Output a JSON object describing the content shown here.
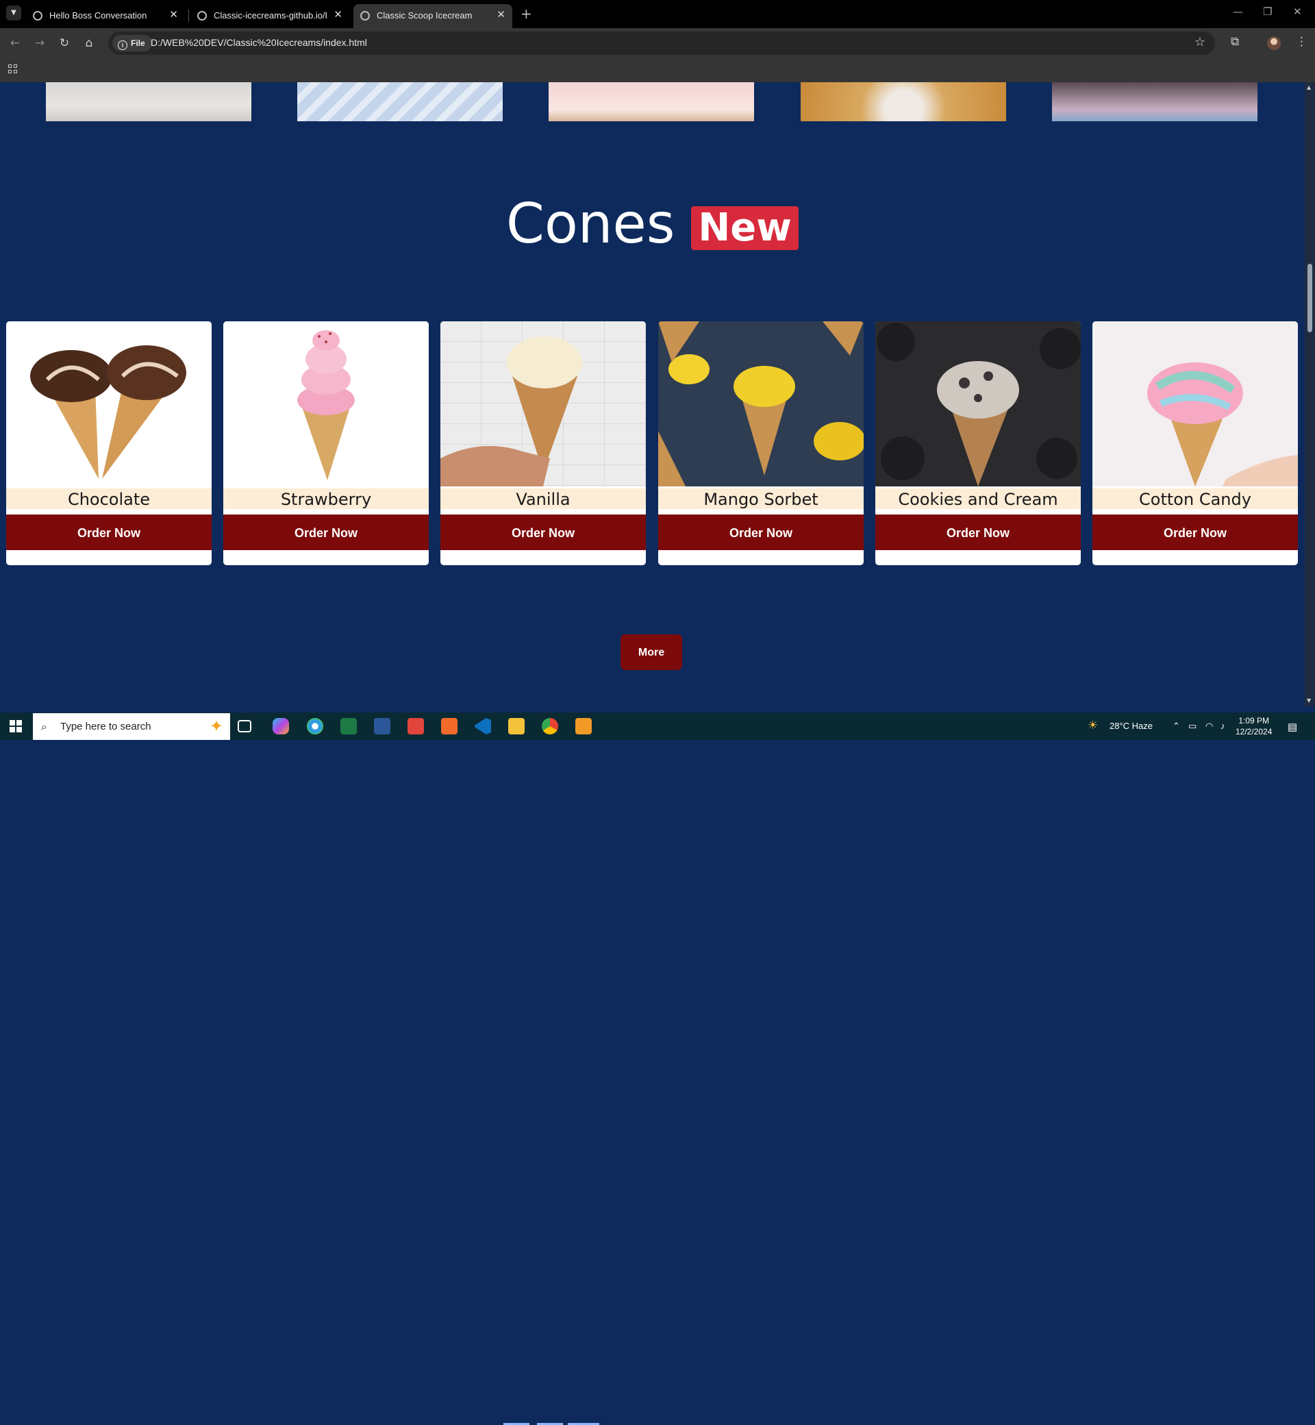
{
  "browser": {
    "tabs": [
      {
        "title": "Hello Boss Conversation",
        "active": false
      },
      {
        "title": "Classic-icecreams-github.io/README",
        "active": false
      },
      {
        "title": "Classic Scoop Icecream",
        "active": true
      }
    ],
    "address": {
      "chip": "File",
      "url": "D:/WEB%20DEV/Classic%20Icecreams/index.html"
    }
  },
  "page": {
    "section_title": "Cones",
    "badge": "New",
    "cards": [
      {
        "name": "Chocolate",
        "button": "Order Now"
      },
      {
        "name": "Strawberry",
        "button": "Order Now"
      },
      {
        "name": "Vanilla",
        "button": "Order Now"
      },
      {
        "name": "Mango Sorbet",
        "button": "Order Now"
      },
      {
        "name": "Cookies and Cream",
        "button": "Order Now"
      },
      {
        "name": "Cotton Candy",
        "button": "Order Now"
      }
    ],
    "more_button": "More"
  },
  "taskbar": {
    "search_placeholder": "Type here to search",
    "weather": "28°C  Haze",
    "time": "1:09 PM",
    "date": "12/2/2024"
  },
  "colors": {
    "page_bg": "#0e2a5c",
    "order_button": "#7d0a0a",
    "badge": "#d72a3c",
    "name_strip": "#fdecd6"
  }
}
